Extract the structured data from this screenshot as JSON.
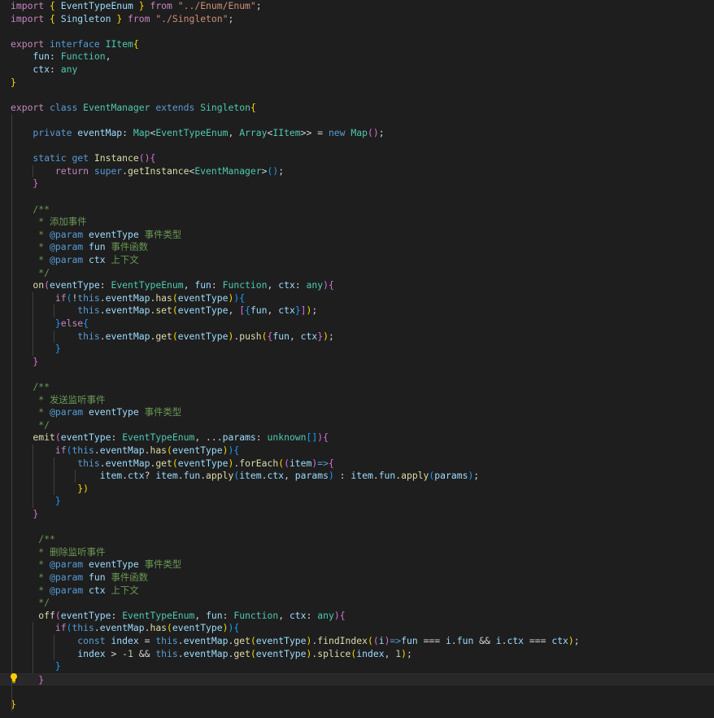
{
  "file": {
    "language": "TypeScript",
    "lines": [
      [
        [
          "import ",
          "kw"
        ],
        [
          "{ ",
          "b1"
        ],
        [
          "EventTypeEnum ",
          "vr"
        ],
        [
          "} ",
          "b1"
        ],
        [
          "from ",
          "kw"
        ],
        [
          "\"../Enum/Enum\"",
          "sr"
        ],
        [
          ";",
          "pn"
        ]
      ],
      [
        [
          "import ",
          "kw"
        ],
        [
          "{ ",
          "b1"
        ],
        [
          "Singleton ",
          "vr"
        ],
        [
          "} ",
          "b1"
        ],
        [
          "from ",
          "kw"
        ],
        [
          "\"./Singleton\"",
          "sr"
        ],
        [
          ";",
          "pn"
        ]
      ],
      [],
      [
        [
          "export ",
          "kw"
        ],
        [
          "interface ",
          "st"
        ],
        [
          "IItem",
          "ty"
        ],
        [
          "{",
          "b1"
        ]
      ],
      [
        [
          "    fun",
          "vr"
        ],
        [
          ": ",
          "pn"
        ],
        [
          "Function",
          "ty"
        ],
        [
          ",",
          "pn"
        ]
      ],
      [
        [
          "    ctx",
          "vr"
        ],
        [
          ": ",
          "pn"
        ],
        [
          "any",
          "ty"
        ]
      ],
      [
        [
          "}",
          "b1"
        ]
      ],
      [],
      [
        [
          "export ",
          "kw"
        ],
        [
          "class ",
          "st"
        ],
        [
          "EventManager ",
          "ty"
        ],
        [
          "extends ",
          "st"
        ],
        [
          "Singleton",
          "ty"
        ],
        [
          "{",
          "b1"
        ]
      ],
      [],
      [
        [
          "    private ",
          "st"
        ],
        [
          "eventMap",
          "vr"
        ],
        [
          ": ",
          "pn"
        ],
        [
          "Map",
          "ty"
        ],
        [
          "<",
          "pn"
        ],
        [
          "EventTypeEnum",
          "ty"
        ],
        [
          ", ",
          "pn"
        ],
        [
          "Array",
          "ty"
        ],
        [
          "<",
          "pn"
        ],
        [
          "IItem",
          "ty"
        ],
        [
          ">> = ",
          "pn"
        ],
        [
          "new ",
          "st"
        ],
        [
          "Map",
          "ty"
        ],
        [
          "()",
          "b2"
        ],
        [
          ";",
          "pn"
        ]
      ],
      [],
      [
        [
          "    static ",
          "st"
        ],
        [
          "get ",
          "st"
        ],
        [
          "Instance",
          "fn"
        ],
        [
          "()",
          "b2"
        ],
        [
          "{",
          "b2"
        ]
      ],
      [
        [
          "        return ",
          "kw"
        ],
        [
          "super",
          "st"
        ],
        [
          ".",
          "pn"
        ],
        [
          "getInstance",
          "fn"
        ],
        [
          "<",
          "pn"
        ],
        [
          "EventManager",
          "ty"
        ],
        [
          ">",
          "pn"
        ],
        [
          "()",
          "b3"
        ],
        [
          ";",
          "pn"
        ]
      ],
      [
        [
          "    }",
          "b2"
        ]
      ],
      [],
      [
        [
          "    /**",
          "cm"
        ]
      ],
      [
        [
          "     * 添加事件",
          "cm"
        ]
      ],
      [
        [
          "     * ",
          "cm"
        ],
        [
          "@param ",
          "st"
        ],
        [
          "eventType ",
          "vr"
        ],
        [
          "事件类型",
          "cm"
        ]
      ],
      [
        [
          "     * ",
          "cm"
        ],
        [
          "@param ",
          "st"
        ],
        [
          "fun ",
          "vr"
        ],
        [
          "事件函数",
          "cm"
        ]
      ],
      [
        [
          "     * ",
          "cm"
        ],
        [
          "@param ",
          "st"
        ],
        [
          "ctx ",
          "vr"
        ],
        [
          "上下文",
          "cm"
        ]
      ],
      [
        [
          "     */",
          "cm"
        ]
      ],
      [
        [
          "    on",
          "fn"
        ],
        [
          "(",
          "b2"
        ],
        [
          "eventType",
          "vr"
        ],
        [
          ": ",
          "pn"
        ],
        [
          "EventTypeEnum",
          "ty"
        ],
        [
          ", ",
          "pn"
        ],
        [
          "fun",
          "vr"
        ],
        [
          ": ",
          "pn"
        ],
        [
          "Function",
          "ty"
        ],
        [
          ", ",
          "pn"
        ],
        [
          "ctx",
          "vr"
        ],
        [
          ": ",
          "pn"
        ],
        [
          "any",
          "ty"
        ],
        [
          ")",
          "b2"
        ],
        [
          "{",
          "b2"
        ]
      ],
      [
        [
          "        if",
          "kw"
        ],
        [
          "(",
          "b3"
        ],
        [
          "!",
          "pn"
        ],
        [
          "this",
          "st"
        ],
        [
          ".",
          "pn"
        ],
        [
          "eventMap",
          "vr"
        ],
        [
          ".",
          "pn"
        ],
        [
          "has",
          "fn"
        ],
        [
          "(",
          "b1"
        ],
        [
          "eventType",
          "vr"
        ],
        [
          ")",
          "b1"
        ],
        [
          ")",
          "b3"
        ],
        [
          "{",
          "b3"
        ]
      ],
      [
        [
          "            this",
          "st"
        ],
        [
          ".",
          "pn"
        ],
        [
          "eventMap",
          "vr"
        ],
        [
          ".",
          "pn"
        ],
        [
          "set",
          "fn"
        ],
        [
          "(",
          "b1"
        ],
        [
          "eventType",
          "vr"
        ],
        [
          ", ",
          "pn"
        ],
        [
          "[",
          "b2"
        ],
        [
          "{",
          "b3"
        ],
        [
          "fun",
          "vr"
        ],
        [
          ", ",
          "pn"
        ],
        [
          "ctx",
          "vr"
        ],
        [
          "}",
          "b3"
        ],
        [
          "]",
          "b2"
        ],
        [
          ")",
          "b1"
        ],
        [
          ";",
          "pn"
        ]
      ],
      [
        [
          "        }",
          "b3"
        ],
        [
          "else",
          "kw"
        ],
        [
          "{",
          "b3"
        ]
      ],
      [
        [
          "            this",
          "st"
        ],
        [
          ".",
          "pn"
        ],
        [
          "eventMap",
          "vr"
        ],
        [
          ".",
          "pn"
        ],
        [
          "get",
          "fn"
        ],
        [
          "(",
          "b1"
        ],
        [
          "eventType",
          "vr"
        ],
        [
          ")",
          "b1"
        ],
        [
          ".",
          "pn"
        ],
        [
          "push",
          "fn"
        ],
        [
          "(",
          "b1"
        ],
        [
          "{",
          "b2"
        ],
        [
          "fun",
          "vr"
        ],
        [
          ", ",
          "pn"
        ],
        [
          "ctx",
          "vr"
        ],
        [
          "}",
          "b2"
        ],
        [
          ")",
          "b1"
        ],
        [
          ";",
          "pn"
        ]
      ],
      [
        [
          "        }",
          "b3"
        ]
      ],
      [
        [
          "    }",
          "b2"
        ]
      ],
      [],
      [
        [
          "    /**",
          "cm"
        ]
      ],
      [
        [
          "     * 发送监听事件",
          "cm"
        ]
      ],
      [
        [
          "     * ",
          "cm"
        ],
        [
          "@param ",
          "st"
        ],
        [
          "eventType ",
          "vr"
        ],
        [
          "事件类型",
          "cm"
        ]
      ],
      [
        [
          "     */",
          "cm"
        ]
      ],
      [
        [
          "    emit",
          "fn"
        ],
        [
          "(",
          "b2"
        ],
        [
          "eventType",
          "vr"
        ],
        [
          ": ",
          "pn"
        ],
        [
          "EventTypeEnum",
          "ty"
        ],
        [
          ", ...",
          "pn"
        ],
        [
          "params",
          "vr"
        ],
        [
          ": ",
          "pn"
        ],
        [
          "unknown",
          "ty"
        ],
        [
          "[]",
          "b3"
        ],
        [
          ")",
          "b2"
        ],
        [
          "{",
          "b2"
        ]
      ],
      [
        [
          "        if",
          "kw"
        ],
        [
          "(",
          "b3"
        ],
        [
          "this",
          "st"
        ],
        [
          ".",
          "pn"
        ],
        [
          "eventMap",
          "vr"
        ],
        [
          ".",
          "pn"
        ],
        [
          "has",
          "fn"
        ],
        [
          "(",
          "b1"
        ],
        [
          "eventType",
          "vr"
        ],
        [
          ")",
          "b1"
        ],
        [
          ")",
          "b3"
        ],
        [
          "{",
          "b3"
        ]
      ],
      [
        [
          "            this",
          "st"
        ],
        [
          ".",
          "pn"
        ],
        [
          "eventMap",
          "vr"
        ],
        [
          ".",
          "pn"
        ],
        [
          "get",
          "fn"
        ],
        [
          "(",
          "b1"
        ],
        [
          "eventType",
          "vr"
        ],
        [
          ")",
          "b1"
        ],
        [
          ".",
          "pn"
        ],
        [
          "forEach",
          "fn"
        ],
        [
          "(",
          "b1"
        ],
        [
          "(",
          "b2"
        ],
        [
          "item",
          "vr"
        ],
        [
          ")",
          "b2"
        ],
        [
          "=>",
          "st"
        ],
        [
          "{",
          "b2"
        ]
      ],
      [
        [
          "                item",
          "vr"
        ],
        [
          ".",
          "pn"
        ],
        [
          "ctx",
          "vr"
        ],
        [
          "? ",
          "pn"
        ],
        [
          "item",
          "vr"
        ],
        [
          ".",
          "pn"
        ],
        [
          "fun",
          "vr"
        ],
        [
          ".",
          "pn"
        ],
        [
          "apply",
          "fn"
        ],
        [
          "(",
          "b3"
        ],
        [
          "item",
          "vr"
        ],
        [
          ".",
          "pn"
        ],
        [
          "ctx",
          "vr"
        ],
        [
          ", ",
          "pn"
        ],
        [
          "params",
          "vr"
        ],
        [
          ")",
          "b3"
        ],
        [
          " : ",
          "pn"
        ],
        [
          "item",
          "vr"
        ],
        [
          ".",
          "pn"
        ],
        [
          "fun",
          "vr"
        ],
        [
          ".",
          "pn"
        ],
        [
          "apply",
          "fn"
        ],
        [
          "(",
          "b3"
        ],
        [
          "params",
          "vr"
        ],
        [
          ")",
          "b3"
        ],
        [
          ";",
          "pn"
        ]
      ],
      [
        [
          "            })",
          "b1"
        ]
      ],
      [
        [
          "        }",
          "b3"
        ]
      ],
      [
        [
          "    }",
          "b2"
        ]
      ],
      [],
      [
        [
          "     /**",
          "cm"
        ]
      ],
      [
        [
          "     * 删除监听事件",
          "cm"
        ]
      ],
      [
        [
          "     * ",
          "cm"
        ],
        [
          "@param ",
          "st"
        ],
        [
          "eventType ",
          "vr"
        ],
        [
          "事件类型",
          "cm"
        ]
      ],
      [
        [
          "     * ",
          "cm"
        ],
        [
          "@param ",
          "st"
        ],
        [
          "fun ",
          "vr"
        ],
        [
          "事件函数",
          "cm"
        ]
      ],
      [
        [
          "     * ",
          "cm"
        ],
        [
          "@param ",
          "st"
        ],
        [
          "ctx ",
          "vr"
        ],
        [
          "上下文",
          "cm"
        ]
      ],
      [
        [
          "     */",
          "cm"
        ]
      ],
      [
        [
          "     off",
          "fn"
        ],
        [
          "(",
          "b2"
        ],
        [
          "eventType",
          "vr"
        ],
        [
          ": ",
          "pn"
        ],
        [
          "EventTypeEnum",
          "ty"
        ],
        [
          ", ",
          "pn"
        ],
        [
          "fun",
          "vr"
        ],
        [
          ": ",
          "pn"
        ],
        [
          "Function",
          "ty"
        ],
        [
          ", ",
          "pn"
        ],
        [
          "ctx",
          "vr"
        ],
        [
          ": ",
          "pn"
        ],
        [
          "any",
          "ty"
        ],
        [
          ")",
          "b2"
        ],
        [
          "{",
          "b2"
        ]
      ],
      [
        [
          "        if",
          "kw"
        ],
        [
          "(",
          "b3"
        ],
        [
          "this",
          "st"
        ],
        [
          ".",
          "pn"
        ],
        [
          "eventMap",
          "vr"
        ],
        [
          ".",
          "pn"
        ],
        [
          "has",
          "fn"
        ],
        [
          "(",
          "b1"
        ],
        [
          "eventType",
          "vr"
        ],
        [
          ")",
          "b1"
        ],
        [
          ")",
          "b3"
        ],
        [
          "{",
          "b3"
        ]
      ],
      [
        [
          "            const ",
          "st"
        ],
        [
          "index ",
          "vr"
        ],
        [
          "= ",
          "pn"
        ],
        [
          "this",
          "st"
        ],
        [
          ".",
          "pn"
        ],
        [
          "eventMap",
          "vr"
        ],
        [
          ".",
          "pn"
        ],
        [
          "get",
          "fn"
        ],
        [
          "(",
          "b1"
        ],
        [
          "eventType",
          "vr"
        ],
        [
          ")",
          "b1"
        ],
        [
          ".",
          "pn"
        ],
        [
          "findIndex",
          "fn"
        ],
        [
          "(",
          "b1"
        ],
        [
          "(",
          "b2"
        ],
        [
          "i",
          "vr"
        ],
        [
          ")",
          "b2"
        ],
        [
          "=>",
          "st"
        ],
        [
          "fun ",
          "vr"
        ],
        [
          "=== ",
          "pn"
        ],
        [
          "i",
          "vr"
        ],
        [
          ".",
          "pn"
        ],
        [
          "fun ",
          "vr"
        ],
        [
          "&& ",
          "pn"
        ],
        [
          "i",
          "vr"
        ],
        [
          ".",
          "pn"
        ],
        [
          "ctx ",
          "vr"
        ],
        [
          "=== ",
          "pn"
        ],
        [
          "ctx",
          "vr"
        ],
        [
          ")",
          "b1"
        ],
        [
          ";",
          "pn"
        ]
      ],
      [
        [
          "            index ",
          "vr"
        ],
        [
          "> -",
          "pn"
        ],
        [
          "1 ",
          "nm"
        ],
        [
          "&& ",
          "pn"
        ],
        [
          "this",
          "st"
        ],
        [
          ".",
          "pn"
        ],
        [
          "eventMap",
          "vr"
        ],
        [
          ".",
          "pn"
        ],
        [
          "get",
          "fn"
        ],
        [
          "(",
          "b1"
        ],
        [
          "eventType",
          "vr"
        ],
        [
          ")",
          "b1"
        ],
        [
          ".",
          "pn"
        ],
        [
          "splice",
          "fn"
        ],
        [
          "(",
          "b1"
        ],
        [
          "index",
          "vr"
        ],
        [
          ", ",
          "pn"
        ],
        [
          "1",
          "nm"
        ],
        [
          ")",
          "b1"
        ],
        [
          ";",
          "pn"
        ]
      ],
      [
        [
          "        }",
          "b3"
        ]
      ],
      [
        [
          "     }",
          "b2"
        ]
      ],
      [],
      [
        [
          "}",
          "b1"
        ]
      ]
    ],
    "current_line": 53
  },
  "theme": {
    "background": "#1e1e1e",
    "keyword_control": "#c586c0",
    "keyword_storage": "#569cd6",
    "type": "#4ec9b0",
    "function": "#dcdcaa",
    "variable": "#9cdcfe",
    "string": "#ce9178",
    "comment": "#6a9955",
    "number": "#b5cea8"
  },
  "gutter_icon": "lightbulb-icon"
}
